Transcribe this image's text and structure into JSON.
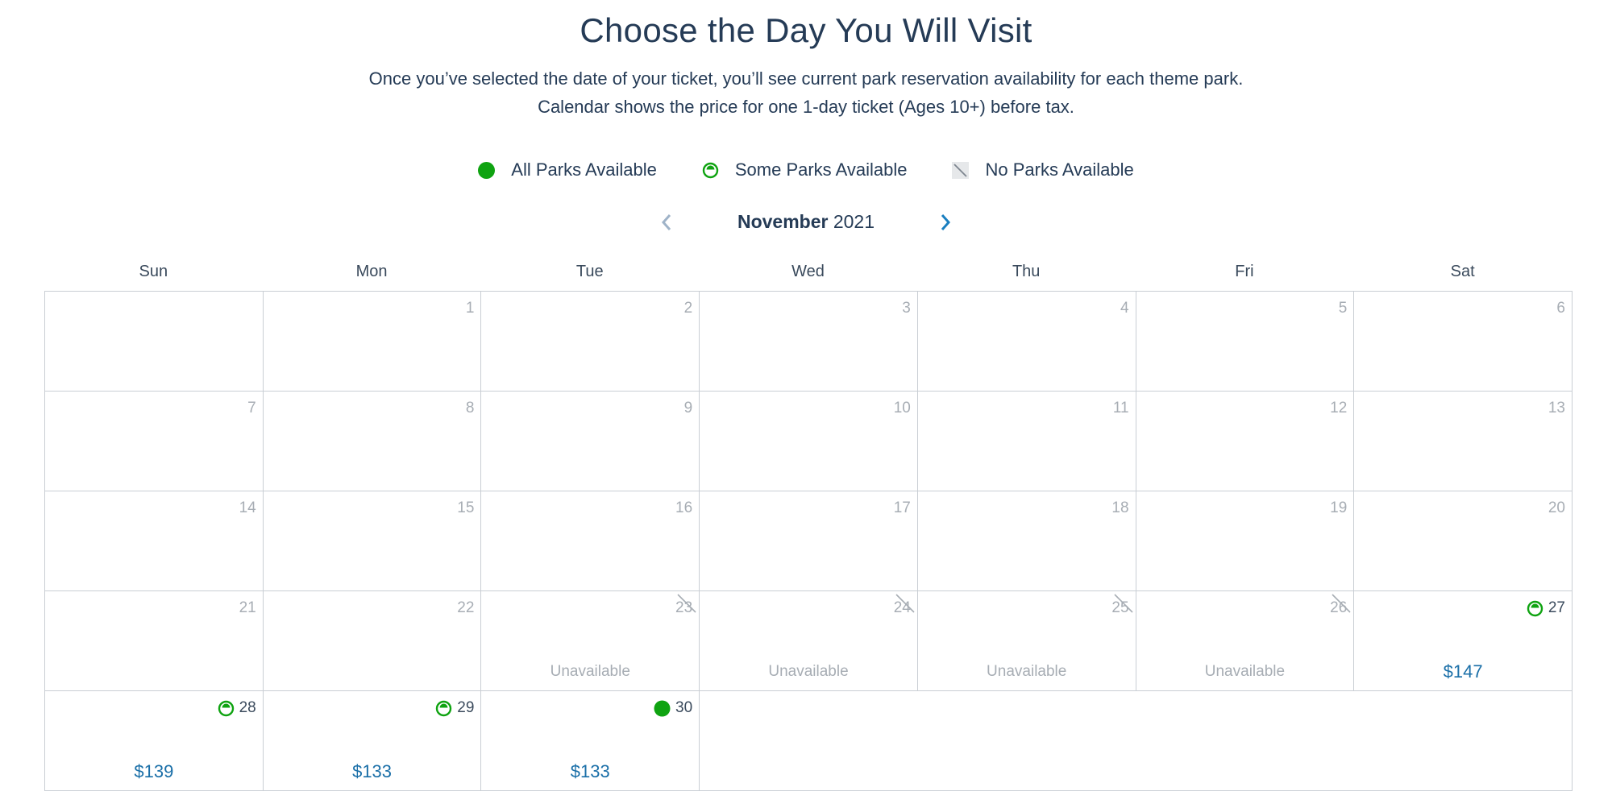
{
  "header": {
    "title": "Choose the Day You Will Visit",
    "subtitle": "Once you’ve selected the date of your ticket, you’ll see current park reservation availability for each theme park. Calendar shows the price for one 1-day ticket (Ages 10+) before tax."
  },
  "legend": {
    "all": "All Parks Available",
    "some": "Some Parks Available",
    "none": "No Parks Available"
  },
  "colors": {
    "available": "#0fa311",
    "price": "#1a6fa8",
    "text": "#253b56",
    "muted": "#a7adb4",
    "nav_prev": "#9fb3c8",
    "nav_next": "#1a7fc0"
  },
  "calendar": {
    "month": "November",
    "year": "2021",
    "weekdays": [
      "Sun",
      "Mon",
      "Tue",
      "Wed",
      "Thu",
      "Fri",
      "Sat"
    ],
    "unavailable_label": "Unavailable",
    "days": {
      "d1": "1",
      "d2": "2",
      "d3": "3",
      "d4": "4",
      "d5": "5",
      "d6": "6",
      "d7": "7",
      "d8": "8",
      "d9": "9",
      "d10": "10",
      "d11": "11",
      "d12": "12",
      "d13": "13",
      "d14": "14",
      "d15": "15",
      "d16": "16",
      "d17": "17",
      "d18": "18",
      "d19": "19",
      "d20": "20",
      "d21": "21",
      "d22": "22",
      "d23": "23",
      "d24": "24",
      "d25": "25",
      "d26": "26",
      "d27": "27",
      "d28": "28",
      "d29": "29",
      "d30": "30"
    },
    "prices": {
      "d27": "$147",
      "d28": "$139",
      "d29": "$133",
      "d30": "$133"
    },
    "status": {
      "d23": "none",
      "d24": "none",
      "d25": "none",
      "d26": "none",
      "d27": "some",
      "d28": "some",
      "d29": "some",
      "d30": "all"
    }
  }
}
